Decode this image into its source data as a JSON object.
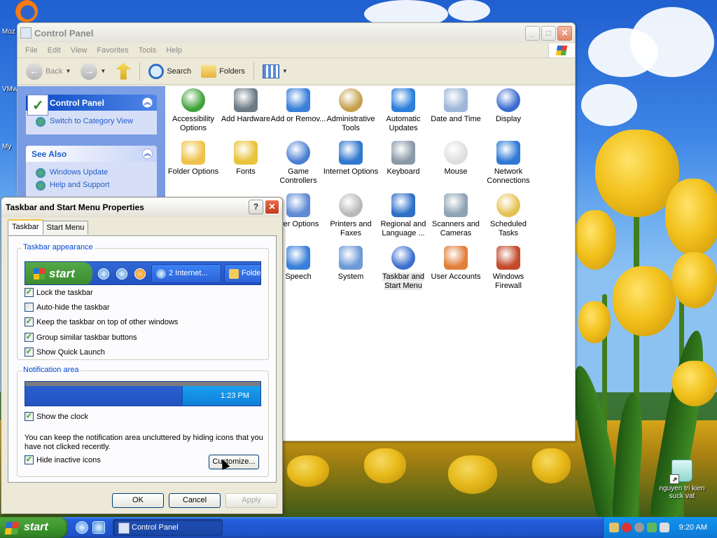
{
  "desktop": {
    "left_labels": [
      "Moz",
      "VMw",
      "My"
    ],
    "recycle_label": "nguyen tri kien suck vat"
  },
  "control_panel": {
    "title": "Control Panel",
    "menu": [
      "File",
      "Edit",
      "View",
      "Favorites",
      "Tools",
      "Help"
    ],
    "toolbar": {
      "back": "Back",
      "search": "Search",
      "folders": "Folders"
    },
    "sidebar": {
      "panel_title": "Control Panel",
      "switch_link": "Switch to Category View",
      "see_also_title": "See Also",
      "see_also": [
        "Windows Update",
        "Help and Support"
      ]
    },
    "items": [
      "Accessibility Options",
      "Add Hardware",
      "Add or Remov...",
      "Administrative Tools",
      "Automatic Updates",
      "Date and Time",
      "Display",
      "Folder Options",
      "Fonts",
      "Game Controllers",
      "Internet Options",
      "Keyboard",
      "Mouse",
      "Network Connections",
      "wer Options",
      "Printers and Faxes",
      "Regional and Language ...",
      "Scanners and Cameras",
      "Scheduled Tasks",
      "Speech",
      "System",
      "Taskbar and Start Menu",
      "User Accounts",
      "Windows Firewall"
    ]
  },
  "dialog": {
    "title": "Taskbar and Start Menu Properties",
    "tabs": [
      "Taskbar",
      "Start Menu"
    ],
    "appearance_legend": "Taskbar appearance",
    "preview": {
      "start": "start",
      "window1": "2 Internet...",
      "window2": "Folde"
    },
    "options": [
      {
        "label": "Lock the taskbar",
        "checked": true
      },
      {
        "label": "Auto-hide the taskbar",
        "checked": false
      },
      {
        "label": "Keep the taskbar on top of other windows",
        "checked": true
      },
      {
        "label": "Group similar taskbar buttons",
        "checked": true
      },
      {
        "label": "Show Quick Launch",
        "checked": true
      }
    ],
    "notify_legend": "Notification area",
    "notify_time": "1:23 PM",
    "show_clock": "Show the clock",
    "notify_text": "You can keep the notification area uncluttered by hiding icons that you have not clicked recently.",
    "hide_inactive": "Hide inactive icons",
    "customize": "Customize...",
    "ok": "OK",
    "cancel": "Cancel",
    "apply": "Apply"
  },
  "taskbar": {
    "start": "start",
    "active_window": "Control Panel",
    "clock": "9:20 AM"
  },
  "colors": {
    "xp_blue": "#245edb",
    "start_green": "#3b922b",
    "link_blue": "#215dc6",
    "group_legend": "#0046d5"
  }
}
